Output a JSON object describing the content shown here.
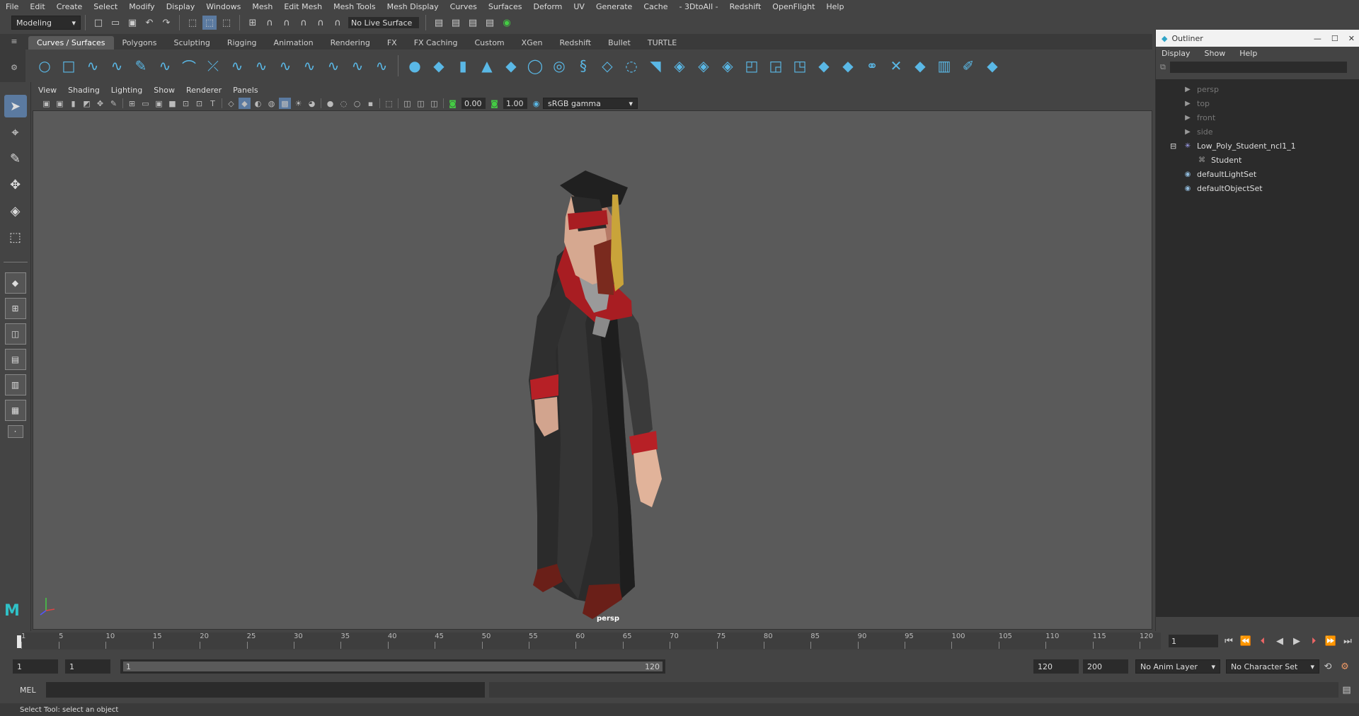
{
  "menubar": [
    "File",
    "Edit",
    "Create",
    "Select",
    "Modify",
    "Display",
    "Windows",
    "Mesh",
    "Edit Mesh",
    "Mesh Tools",
    "Mesh Display",
    "Curves",
    "Surfaces",
    "Deform",
    "UV",
    "Generate",
    "Cache",
    "- 3DtoAll -",
    "Redshift",
    "OpenFlight",
    "Help"
  ],
  "status": {
    "mode": "Modeling",
    "live_surface": "No Live Surface"
  },
  "shelf_tabs": [
    "Curves / Surfaces",
    "Polygons",
    "Sculpting",
    "Rigging",
    "Animation",
    "Rendering",
    "FX",
    "FX Caching",
    "Custom",
    "XGen",
    "Redshift",
    "Bullet",
    "TURTLE"
  ],
  "viewport": {
    "menu": [
      "View",
      "Shading",
      "Lighting",
      "Show",
      "Renderer",
      "Panels"
    ],
    "exposure": "0.00",
    "gamma": "1.00",
    "color_space": "sRGB gamma",
    "camera_label": "persp"
  },
  "timeline": {
    "ticks": [
      "1",
      "5",
      "10",
      "15",
      "20",
      "25",
      "30",
      "35",
      "40",
      "45",
      "50",
      "55",
      "60",
      "65",
      "70",
      "75",
      "80",
      "85",
      "90",
      "95",
      "100",
      "105",
      "110",
      "115",
      "120"
    ],
    "current_frame": "1"
  },
  "range": {
    "start": "1",
    "playback_start": "1",
    "slider_start": "1",
    "slider_end": "120",
    "playback_end": "120",
    "end": "200",
    "anim_layer": "No Anim Layer",
    "character_set": "No Character Set"
  },
  "cmd": {
    "label": "MEL",
    "help": "Select Tool: select an object"
  },
  "outliner": {
    "title": "Outliner",
    "menu": [
      "Display",
      "Show",
      "Help"
    ],
    "items": [
      {
        "label": "persp",
        "icon": "camera-icon",
        "dim": true,
        "indent": 0
      },
      {
        "label": "top",
        "icon": "camera-icon",
        "dim": true,
        "indent": 0
      },
      {
        "label": "front",
        "icon": "camera-icon",
        "dim": true,
        "indent": 0
      },
      {
        "label": "side",
        "icon": "camera-icon",
        "dim": true,
        "indent": 0
      },
      {
        "label": "Low_Poly_Student_ncl1_1",
        "icon": "group-icon",
        "dim": false,
        "indent": 0
      },
      {
        "label": "Student",
        "icon": "mesh-icon",
        "dim": false,
        "indent": 1
      },
      {
        "label": "defaultLightSet",
        "icon": "set-icon",
        "dim": false,
        "indent": 0
      },
      {
        "label": "defaultObjectSet",
        "icon": "set-icon",
        "dim": false,
        "indent": 0
      }
    ]
  }
}
